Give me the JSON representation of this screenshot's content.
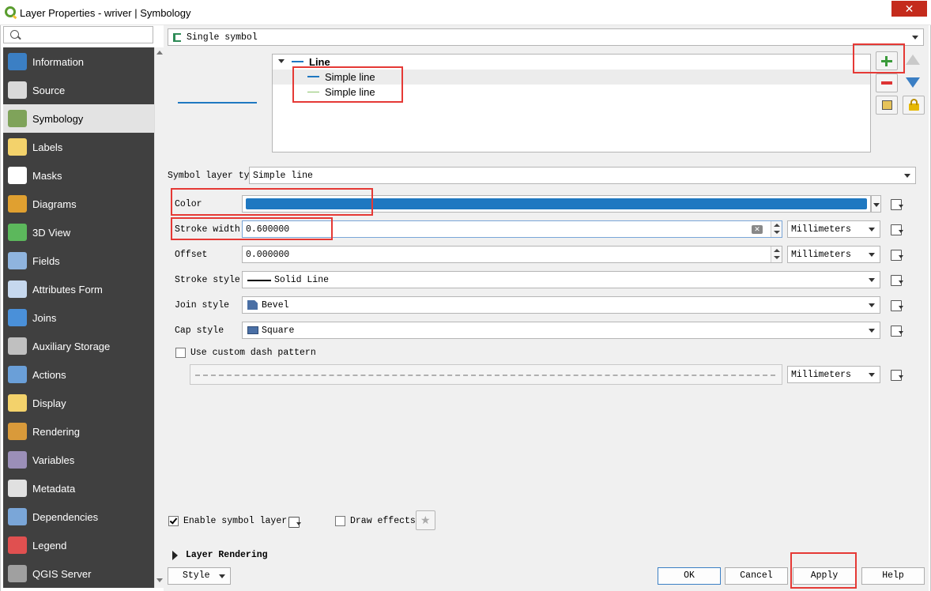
{
  "window": {
    "title": "Layer Properties - wriver | Symbology",
    "close_glyph": "✕"
  },
  "search": {
    "placeholder": ""
  },
  "sidebar": {
    "items": [
      {
        "label": "Information",
        "icon": "information-icon",
        "color": "#3b7fc4"
      },
      {
        "label": "Source",
        "icon": "source-icon",
        "color": "#d9d9d9"
      },
      {
        "label": "Symbology",
        "icon": "symbology-icon",
        "color": "#7fa35a"
      },
      {
        "label": "Labels",
        "icon": "labels-icon",
        "color": "#f3d26b"
      },
      {
        "label": "Masks",
        "icon": "masks-icon",
        "color": "#ffffff"
      },
      {
        "label": "Diagrams",
        "icon": "diagrams-icon",
        "color": "#e0a030"
      },
      {
        "label": "3D View",
        "icon": "3d-view-icon",
        "color": "#5cb85c"
      },
      {
        "label": "Fields",
        "icon": "fields-icon",
        "color": "#8fb4de"
      },
      {
        "label": "Attributes Form",
        "icon": "attributes-form-icon",
        "color": "#c6d8ee"
      },
      {
        "label": "Joins",
        "icon": "joins-icon",
        "color": "#4a90d9"
      },
      {
        "label": "Auxiliary Storage",
        "icon": "auxiliary-storage-icon",
        "color": "#c0c0c0"
      },
      {
        "label": "Actions",
        "icon": "actions-icon",
        "color": "#6a9fd8"
      },
      {
        "label": "Display",
        "icon": "display-icon",
        "color": "#f3d26b"
      },
      {
        "label": "Rendering",
        "icon": "rendering-icon",
        "color": "#d99a3a"
      },
      {
        "label": "Variables",
        "icon": "variables-icon",
        "color": "#9b8fb8"
      },
      {
        "label": "Metadata",
        "icon": "metadata-icon",
        "color": "#e0e0e0"
      },
      {
        "label": "Dependencies",
        "icon": "dependencies-icon",
        "color": "#7aa6d8"
      },
      {
        "label": "Legend",
        "icon": "legend-icon",
        "color": "#e05050"
      },
      {
        "label": "QGIS Server",
        "icon": "qgis-server-icon",
        "color": "#a0a0a0"
      }
    ],
    "active_index": 2
  },
  "renderer": {
    "value": "Single symbol"
  },
  "symbol_tree": {
    "root": "Line",
    "layers": [
      {
        "label": "Simple line",
        "color": "#1f78c1"
      },
      {
        "label": "Simple line",
        "color": "#8bc36b"
      }
    ]
  },
  "symbol_layer_type": {
    "label": "Symbol layer type",
    "value": "Simple line"
  },
  "props": {
    "color_label": "Color",
    "color_value": "#1f78c1",
    "stroke_width_label": "Stroke width",
    "stroke_width_value": "0.600000",
    "stroke_width_unit": "Millimeters",
    "offset_label": "Offset",
    "offset_value": "0.000000",
    "offset_unit": "Millimeters",
    "stroke_style_label": "Stroke style",
    "stroke_style_value": "Solid Line",
    "join_style_label": "Join style",
    "join_style_value": "Bevel",
    "cap_style_label": "Cap style",
    "cap_style_value": "Square",
    "custom_dash_label": "Use custom dash pattern",
    "dash_unit": "Millimeters"
  },
  "footer": {
    "enable_symbol_layer": "Enable symbol layer",
    "draw_effects": "Draw effects",
    "layer_rendering": "Layer Rendering",
    "style": "Style",
    "ok": "OK",
    "cancel": "Cancel",
    "apply": "Apply",
    "help": "Help"
  },
  "colors": {
    "highlight": "#e53935",
    "accent": "#1f78c1"
  }
}
